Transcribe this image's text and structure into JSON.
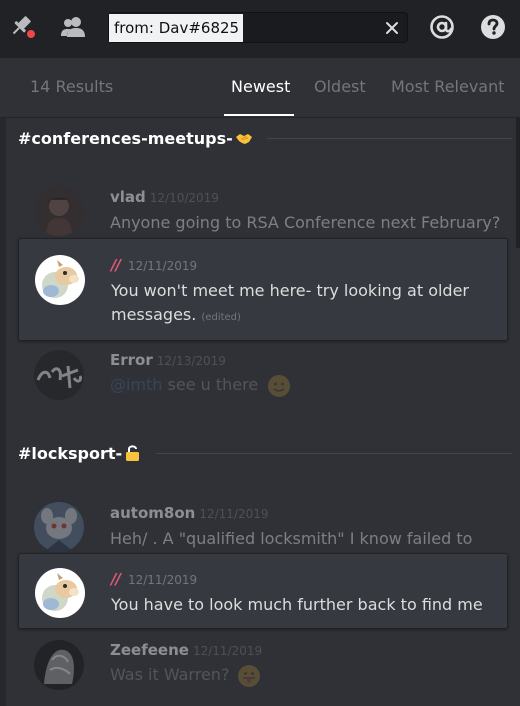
{
  "search": {
    "value": "from: Dav#6825"
  },
  "results": {
    "count": "14 Results",
    "tabs": [
      {
        "label": "Newest",
        "active": true
      },
      {
        "label": "Oldest",
        "active": false
      },
      {
        "label": "Most Relevant",
        "active": false
      }
    ]
  },
  "channels": [
    {
      "name": "#conferences-meetups-",
      "emoji": "handshake-emoji",
      "messages": [
        {
          "author": "vlad",
          "time": "12/10/2019",
          "text": "Anyone going to RSA Conference next February?",
          "context": true
        },
        {
          "author": "//",
          "time": "12/11/2019",
          "text_line1": "You won't meet me here- try looking at older",
          "text_line2": "messages.",
          "edited": "(edited)",
          "context": false
        },
        {
          "author": "Error",
          "time": "12/13/2019",
          "mention": "@imth",
          "text": "see u there",
          "emoji": "slightly-smiling-face-emoji",
          "context": true
        }
      ]
    },
    {
      "name": "#locksport-",
      "emoji": "unlocked-padlock-emoji",
      "messages": [
        {
          "author": "autom8on",
          "time": "12/11/2019",
          "text": "Heh/ . A \"qualified locksmith\" I know failed to",
          "context": true
        },
        {
          "author": "//",
          "time": "12/11/2019",
          "text": "You have to look much further back to find me",
          "context": false
        },
        {
          "author": "Zeefeene",
          "time": "12/11/2019",
          "text": "Was it Warren?",
          "emoji": "tongue-out-face-emoji",
          "context": true
        }
      ]
    }
  ],
  "colors": {
    "background": "#2f3136",
    "topbar": "#202225",
    "highlight_card": "#36393f",
    "slash_author": "#e05a74",
    "mention": "#7289da",
    "muted": "#72767d"
  },
  "icons": [
    "pin-icon",
    "notification-dot-icon",
    "member-list-icon",
    "clear-search-icon",
    "mention-icon",
    "help-icon"
  ]
}
